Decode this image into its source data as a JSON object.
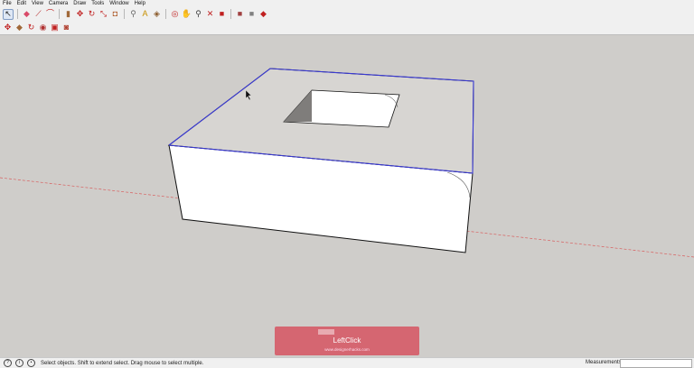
{
  "menu": [
    "File",
    "Edit",
    "View",
    "Camera",
    "Draw",
    "Tools",
    "Window",
    "Help"
  ],
  "toolbar1": [
    {
      "icon": "select-arrow-icon",
      "glyph": "↖",
      "color": "#222222",
      "selected": true
    },
    {
      "icon": "eraser-icon",
      "glyph": "◆",
      "color": "#d94a68"
    },
    {
      "icon": "pencil-line-icon",
      "glyph": "⟋",
      "color": "#b02020"
    },
    {
      "icon": "arc-icon",
      "glyph": "⌒",
      "color": "#c02020"
    },
    {
      "icon": "push-pull-icon",
      "glyph": "▮",
      "color": "#a06838"
    },
    {
      "icon": "move-icon",
      "glyph": "✥",
      "color": "#c02020"
    },
    {
      "icon": "rotate-icon",
      "glyph": "↻",
      "color": "#c02020"
    },
    {
      "icon": "scale-icon",
      "glyph": "⤡",
      "color": "#c02020"
    },
    {
      "icon": "offset-icon",
      "glyph": "◘",
      "color": "#b06030"
    },
    {
      "icon": "tape-measure-icon",
      "glyph": "⚲",
      "color": "#6a6a6a"
    },
    {
      "icon": "text-icon",
      "glyph": "A",
      "color": "#c89000"
    },
    {
      "icon": "paint-bucket-icon",
      "glyph": "◈",
      "color": "#8a5a2a"
    },
    {
      "icon": "orbit-icon",
      "glyph": "◎",
      "color": "#c02020"
    },
    {
      "icon": "pan-icon",
      "glyph": "✋",
      "color": "#c08040"
    },
    {
      "icon": "zoom-icon",
      "glyph": "⚲",
      "color": "#404040"
    },
    {
      "icon": "zoom-extents-icon",
      "glyph": "✕",
      "color": "#c02020"
    },
    {
      "icon": "3d-warehouse-icon",
      "glyph": "■",
      "color": "#c02020"
    },
    {
      "icon": "share-model-icon",
      "glyph": "■",
      "color": "#a04040"
    },
    {
      "icon": "get-models-icon",
      "glyph": "■",
      "color": "#808080"
    },
    {
      "icon": "extension-warehouse-icon",
      "glyph": "◆",
      "color": "#c02020"
    }
  ],
  "toolbar2": [
    {
      "icon": "move-tool-icon",
      "glyph": "✥",
      "color": "#c02020"
    },
    {
      "icon": "push-tool-icon",
      "glyph": "◆",
      "color": "#a06838"
    },
    {
      "icon": "rotate-tool-icon",
      "glyph": "↻",
      "color": "#c02020"
    },
    {
      "icon": "follow-me-icon",
      "glyph": "◉",
      "color": "#b03030"
    },
    {
      "icon": "scale-tool-icon",
      "glyph": "▣",
      "color": "#c02020"
    },
    {
      "icon": "offset-tool-icon",
      "glyph": "◙",
      "color": "#b04030"
    }
  ],
  "status": {
    "text": "Select objects. Shift to extend select. Drag mouse to select multiple.",
    "measurements_label": "Measurements",
    "measurements_value": ""
  },
  "overlay": {
    "title": "LeftClick",
    "site": "www.designerhacks.com"
  },
  "colors": {
    "background": "#cfcdca",
    "selection_edge": "#3a3ad6",
    "axis_red": "#d86060",
    "face_top": "#d7d5d2",
    "face_front": "#ffffff",
    "hole_dark": "#8a8886"
  }
}
